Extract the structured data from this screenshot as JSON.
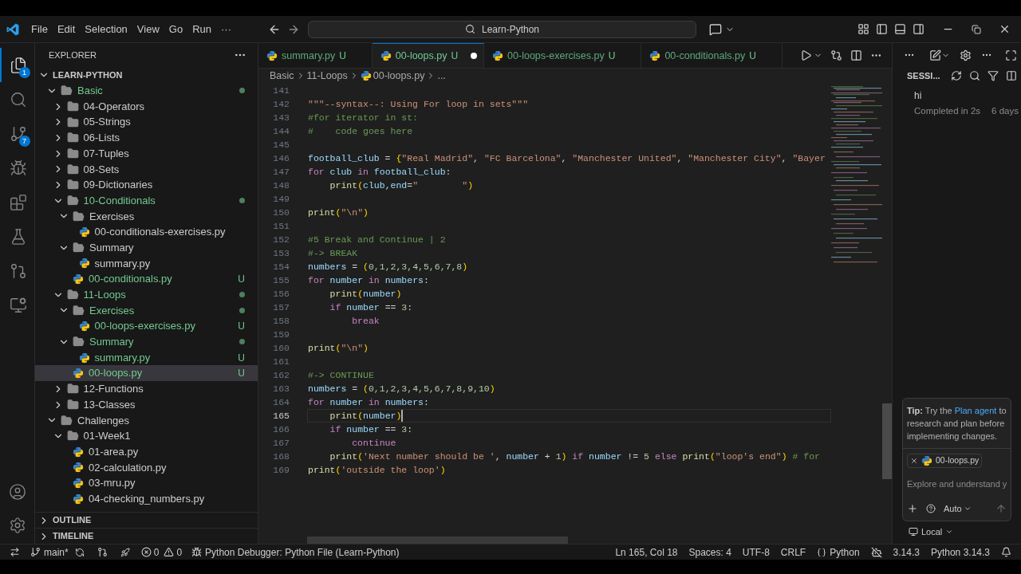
{
  "title_bar": {
    "menu": [
      "File",
      "Edit",
      "Selection",
      "View",
      "Go",
      "Run",
      "···"
    ],
    "search": "Learn-Python"
  },
  "activity_bar": [
    {
      "kind": "explorer",
      "selected": true,
      "badge": "1"
    },
    {
      "kind": "search",
      "selected": false
    },
    {
      "kind": "source-control",
      "selected": false,
      "badge": "7"
    },
    {
      "kind": "run-debug",
      "selected": false
    },
    {
      "kind": "extensions",
      "selected": false
    },
    {
      "kind": "testing",
      "selected": false
    },
    {
      "kind": "git-graph",
      "selected": false
    },
    {
      "kind": "remote",
      "selected": false
    }
  ],
  "sidebar": {
    "title": "EXPLORER",
    "root": {
      "label": "LEARN-PYTHON",
      "expanded": true
    },
    "tree": [
      {
        "label": "Basic",
        "kind": "folder",
        "expanded": true,
        "untracked": true,
        "dot": true,
        "selected": false,
        "children": [
          {
            "label": "04-Operators",
            "kind": "folder",
            "expanded": false,
            "untracked": false,
            "dot": false,
            "selected": false
          },
          {
            "label": "05-Strings",
            "kind": "folder",
            "expanded": false,
            "untracked": false,
            "dot": false,
            "selected": false
          },
          {
            "label": "06-Lists",
            "kind": "folder",
            "expanded": false,
            "untracked": false,
            "dot": false,
            "selected": false
          },
          {
            "label": "07-Tuples",
            "kind": "folder",
            "expanded": false,
            "untracked": false,
            "dot": false,
            "selected": false
          },
          {
            "label": "08-Sets",
            "kind": "folder",
            "expanded": false,
            "untracked": false,
            "dot": false,
            "selected": false
          },
          {
            "label": "09-Dictionaries",
            "kind": "folder",
            "expanded": false,
            "untracked": false,
            "dot": false,
            "selected": false
          },
          {
            "label": "10-Conditionals",
            "kind": "folder",
            "expanded": true,
            "untracked": true,
            "dot": true,
            "selected": false,
            "children": [
              {
                "label": "Exercises",
                "kind": "folder",
                "expanded": true,
                "untracked": false,
                "dot": false,
                "selected": false,
                "children": [
                  {
                    "label": "00-conditionals-exercises.py",
                    "kind": "file",
                    "untracked": false,
                    "dot": false,
                    "selected": false
                  }
                ]
              },
              {
                "label": "Summary",
                "kind": "folder",
                "expanded": true,
                "untracked": false,
                "dot": false,
                "selected": false,
                "children": [
                  {
                    "label": "summary.py",
                    "kind": "file",
                    "untracked": false,
                    "dot": false,
                    "selected": false
                  }
                ]
              },
              {
                "label": "00-conditionals.py",
                "kind": "file",
                "untracked": true,
                "dot": false,
                "badge": "U",
                "selected": false
              }
            ]
          },
          {
            "label": "11-Loops",
            "kind": "folder",
            "expanded": true,
            "untracked": true,
            "dot": true,
            "selected": false,
            "children": [
              {
                "label": "Exercises",
                "kind": "folder",
                "expanded": true,
                "untracked": true,
                "dot": true,
                "selected": false,
                "children": [
                  {
                    "label": "00-loops-exercises.py",
                    "kind": "file",
                    "untracked": true,
                    "dot": false,
                    "badge": "U",
                    "selected": false
                  }
                ]
              },
              {
                "label": "Summary",
                "kind": "folder",
                "expanded": true,
                "untracked": true,
                "dot": true,
                "selected": false,
                "children": [
                  {
                    "label": "summary.py",
                    "kind": "file",
                    "untracked": true,
                    "dot": false,
                    "badge": "U",
                    "selected": false
                  }
                ]
              },
              {
                "label": "00-loops.py",
                "kind": "file",
                "untracked": true,
                "dot": false,
                "badge": "U",
                "selected": true
              }
            ]
          },
          {
            "label": "12-Functions",
            "kind": "folder",
            "expanded": false,
            "untracked": false,
            "dot": false,
            "selected": false
          },
          {
            "label": "13-Classes",
            "kind": "folder",
            "expanded": false,
            "untracked": false,
            "dot": false,
            "selected": false
          }
        ]
      },
      {
        "label": "Challenges",
        "kind": "folder",
        "expanded": true,
        "untracked": false,
        "dot": false,
        "selected": false,
        "children": [
          {
            "label": "01-Week1",
            "kind": "folder",
            "expanded": true,
            "untracked": false,
            "dot": false,
            "selected": false,
            "children": [
              {
                "label": "01-area.py",
                "kind": "file",
                "untracked": false,
                "dot": false,
                "selected": false
              },
              {
                "label": "02-calculation.py",
                "kind": "file",
                "untracked": false,
                "dot": false,
                "selected": false
              },
              {
                "label": "03-mru.py",
                "kind": "file",
                "untracked": false,
                "dot": false,
                "selected": false
              },
              {
                "label": "04-checking_numbers.py",
                "kind": "file",
                "untracked": false,
                "dot": false,
                "selected": false
              }
            ]
          }
        ]
      }
    ],
    "sections": [
      {
        "label": "OUTLINE",
        "expanded": false
      },
      {
        "label": "TIMELINE",
        "expanded": false
      }
    ]
  },
  "tabs": [
    {
      "label": "summary.py",
      "status": "U",
      "selected": false,
      "dirty": false
    },
    {
      "label": "00-loops.py",
      "status": "U",
      "selected": true,
      "dirty": true
    },
    {
      "label": "00-loops-exercises.py",
      "status": "U",
      "selected": false,
      "dirty": false
    },
    {
      "label": "00-conditionals.py",
      "status": "U",
      "selected": false,
      "dirty": false
    }
  ],
  "breadcrumbs": [
    {
      "label": "Basic",
      "kind": "folder"
    },
    {
      "label": "11-Loops",
      "kind": "folder"
    },
    {
      "label": "00-loops.py",
      "kind": "file"
    },
    {
      "label": "...",
      "kind": "more"
    }
  ],
  "editor": {
    "lines": [
      {
        "number": "141",
        "current": false
      },
      {
        "number": "142",
        "current": false,
        "tokens": [
          {
            "kind": "str",
            "text": "\"\"\"--syntax--: Using For loop in sets\"\"\""
          }
        ]
      },
      {
        "number": "143",
        "current": false,
        "tokens": [
          {
            "kind": "com",
            "text": "#for iterator in st:"
          }
        ]
      },
      {
        "number": "144",
        "current": false,
        "tokens": [
          {
            "kind": "com",
            "text": "#    code goes here"
          }
        ]
      },
      {
        "number": "145",
        "current": false
      },
      {
        "number": "146",
        "current": false,
        "tokens": [
          {
            "kind": "var",
            "text": "football_club"
          },
          {
            "kind": "op",
            "text": " = "
          },
          {
            "kind": "br",
            "text": "{"
          },
          {
            "kind": "str",
            "text": "\"Real Madrid\""
          },
          {
            "kind": "op",
            "text": ", "
          },
          {
            "kind": "str",
            "text": "\"FC Barcelona\""
          },
          {
            "kind": "op",
            "text": ", "
          },
          {
            "kind": "str",
            "text": "\"Manchester United\""
          },
          {
            "kind": "op",
            "text": ", "
          },
          {
            "kind": "str",
            "text": "\"Manchester City\""
          },
          {
            "kind": "op",
            "text": ", "
          },
          {
            "kind": "str",
            "text": "\"Bayer"
          }
        ]
      },
      {
        "number": "147",
        "current": false,
        "tokens": [
          {
            "kind": "kw",
            "text": "for"
          },
          {
            "kind": "var",
            "text": " club "
          },
          {
            "kind": "kw",
            "text": "in"
          },
          {
            "kind": "var",
            "text": " football_club"
          },
          {
            "kind": "op",
            "text": ":"
          }
        ]
      },
      {
        "number": "148",
        "current": false,
        "tokens": [
          {
            "kind": "fn",
            "text": "    print"
          },
          {
            "kind": "br",
            "text": "("
          },
          {
            "kind": "var",
            "text": "club"
          },
          {
            "kind": "op",
            "text": ","
          },
          {
            "kind": "var",
            "text": "end"
          },
          {
            "kind": "op",
            "text": "="
          },
          {
            "kind": "str",
            "text": "\"        \""
          },
          {
            "kind": "br",
            "text": ")"
          }
        ]
      },
      {
        "number": "149",
        "current": false
      },
      {
        "number": "150",
        "current": false,
        "tokens": [
          {
            "kind": "fn",
            "text": "print"
          },
          {
            "kind": "br",
            "text": "("
          },
          {
            "kind": "str",
            "text": "\"\\n\""
          },
          {
            "kind": "br",
            "text": ")"
          }
        ]
      },
      {
        "number": "151",
        "current": false
      },
      {
        "number": "152",
        "current": false,
        "tokens": [
          {
            "kind": "com",
            "text": "#5 Break and Continue | 2"
          }
        ]
      },
      {
        "number": "153",
        "current": false,
        "tokens": [
          {
            "kind": "com",
            "text": "#-> BREAK"
          }
        ]
      },
      {
        "number": "154",
        "current": false,
        "tokens": [
          {
            "kind": "var",
            "text": "numbers"
          },
          {
            "kind": "op",
            "text": " = "
          },
          {
            "kind": "br",
            "text": "("
          },
          {
            "kind": "num",
            "text": "0,1,2,3,4,5,6,7,8"
          },
          {
            "kind": "br",
            "text": ")"
          }
        ]
      },
      {
        "number": "155",
        "current": false,
        "tokens": [
          {
            "kind": "kw",
            "text": "for"
          },
          {
            "kind": "var",
            "text": " number "
          },
          {
            "kind": "kw",
            "text": "in"
          },
          {
            "kind": "var",
            "text": " numbers"
          },
          {
            "kind": "op",
            "text": ":"
          }
        ]
      },
      {
        "number": "156",
        "current": false,
        "tokens": [
          {
            "kind": "fn",
            "text": "    print"
          },
          {
            "kind": "br",
            "text": "("
          },
          {
            "kind": "var",
            "text": "number"
          },
          {
            "kind": "br",
            "text": ")"
          }
        ]
      },
      {
        "number": "157",
        "current": false,
        "tokens": [
          {
            "kind": "kw",
            "text": "    if"
          },
          {
            "kind": "var",
            "text": " number "
          },
          {
            "kind": "op",
            "text": "== "
          },
          {
            "kind": "num",
            "text": "3"
          },
          {
            "kind": "op",
            "text": ":"
          }
        ]
      },
      {
        "number": "158",
        "current": false,
        "tokens": [
          {
            "kind": "kw",
            "text": "        break"
          }
        ]
      },
      {
        "number": "159",
        "current": false
      },
      {
        "number": "160",
        "current": false,
        "tokens": [
          {
            "kind": "fn",
            "text": "print"
          },
          {
            "kind": "br",
            "text": "("
          },
          {
            "kind": "str",
            "text": "\"\\n\""
          },
          {
            "kind": "br",
            "text": ")"
          }
        ]
      },
      {
        "number": "161",
        "current": false
      },
      {
        "number": "162",
        "current": false,
        "tokens": [
          {
            "kind": "com",
            "text": "#-> CONTINUE"
          }
        ]
      },
      {
        "number": "163",
        "current": false,
        "tokens": [
          {
            "kind": "var",
            "text": "numbers"
          },
          {
            "kind": "op",
            "text": " = "
          },
          {
            "kind": "br",
            "text": "("
          },
          {
            "kind": "num",
            "text": "0,1,2,3,4,5,6,7,8,9,10"
          },
          {
            "kind": "br",
            "text": ")"
          }
        ]
      },
      {
        "number": "164",
        "current": false,
        "tokens": [
          {
            "kind": "kw",
            "text": "for"
          },
          {
            "kind": "var",
            "text": " number "
          },
          {
            "kind": "kw",
            "text": "in"
          },
          {
            "kind": "var",
            "text": " numbers"
          },
          {
            "kind": "op",
            "text": ":"
          }
        ]
      },
      {
        "number": "165",
        "current": true,
        "tokens": [
          {
            "kind": "fn",
            "text": "    print"
          },
          {
            "kind": "br",
            "text": "("
          },
          {
            "kind": "var",
            "text": "number"
          },
          {
            "kind": "br",
            "text": ")"
          }
        ]
      },
      {
        "number": "166",
        "current": false,
        "tokens": [
          {
            "kind": "kw",
            "text": "    if"
          },
          {
            "kind": "var",
            "text": " number "
          },
          {
            "kind": "op",
            "text": "== "
          },
          {
            "kind": "num",
            "text": "3"
          },
          {
            "kind": "op",
            "text": ":"
          }
        ]
      },
      {
        "number": "167",
        "current": false,
        "tokens": [
          {
            "kind": "kw",
            "text": "        continue"
          }
        ]
      },
      {
        "number": "168",
        "current": false,
        "tokens": [
          {
            "kind": "fn",
            "text": "    print"
          },
          {
            "kind": "br",
            "text": "("
          },
          {
            "kind": "str",
            "text": "'Next number should be '"
          },
          {
            "kind": "op",
            "text": ", "
          },
          {
            "kind": "var",
            "text": "number"
          },
          {
            "kind": "op",
            "text": " + "
          },
          {
            "kind": "num",
            "text": "1"
          },
          {
            "kind": "br",
            "text": ")"
          },
          {
            "kind": "kw",
            "text": " if "
          },
          {
            "kind": "var",
            "text": "number"
          },
          {
            "kind": "op",
            "text": " != "
          },
          {
            "kind": "num",
            "text": "5"
          },
          {
            "kind": "kw",
            "text": " else "
          },
          {
            "kind": "fn",
            "text": "print"
          },
          {
            "kind": "br",
            "text": "("
          },
          {
            "kind": "str",
            "text": "\"loop's end\""
          },
          {
            "kind": "br",
            "text": ")"
          },
          {
            "kind": "com",
            "text": " # for"
          }
        ]
      },
      {
        "number": "169",
        "current": false,
        "tokens": [
          {
            "kind": "fn",
            "text": "print"
          },
          {
            "kind": "br",
            "text": "("
          },
          {
            "kind": "str",
            "text": "'outside the loop'"
          },
          {
            "kind": "br",
            "text": ")"
          }
        ]
      }
    ]
  },
  "chat": {
    "header": "SESSI...",
    "sessions": [
      {
        "title": "hi",
        "detail": "Completed in 2s",
        "age": "6 days"
      }
    ],
    "tip": {
      "lead": "Tip:",
      "before": "Try the",
      "link": "Plan agent",
      "after": "to research and plan before implementing changes."
    },
    "attachment": "00-loops.py",
    "placeholder": "Explore and understand y",
    "mode": "Auto",
    "location": "Local"
  },
  "status_bar": {
    "branch": "main*",
    "errors": "0",
    "warnings": "0",
    "debug": "Python Debugger: Python File (Learn-Python)",
    "right": [
      {
        "kind": "text",
        "text": "Ln 165, Col 18"
      },
      {
        "kind": "text",
        "text": "Spaces: 4"
      },
      {
        "kind": "text",
        "text": "UTF-8"
      },
      {
        "kind": "text",
        "text": "CRLF"
      },
      {
        "kind": "language",
        "text": "Python"
      },
      {
        "kind": "copilot"
      },
      {
        "kind": "text",
        "text": "3.14.3"
      },
      {
        "kind": "text",
        "text": "Python 3.14.3"
      },
      {
        "kind": "bell"
      }
    ]
  }
}
